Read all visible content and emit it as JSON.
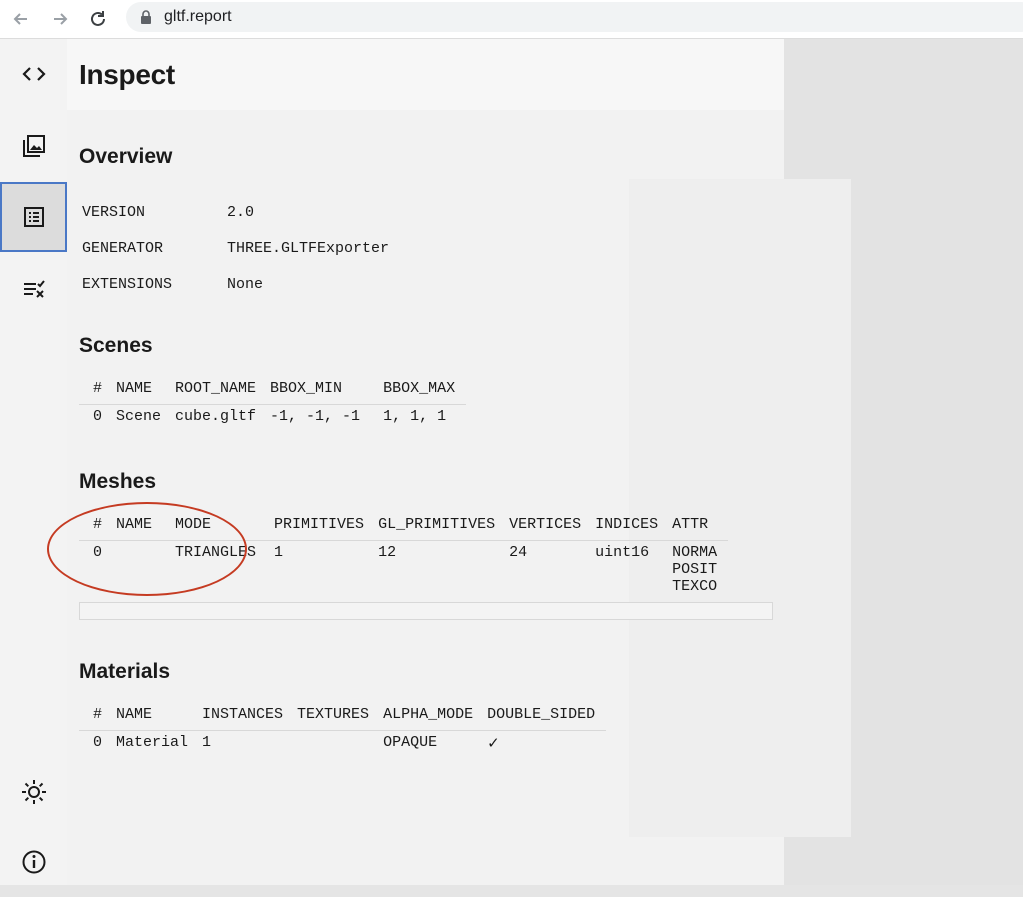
{
  "browser": {
    "url": "gltf.report",
    "back_icon": "arrow-left-icon",
    "forward_icon": "arrow-right-icon",
    "reload_icon": "reload-icon",
    "lock_icon": "lock-icon"
  },
  "sidebar": {
    "items": [
      {
        "name": "script",
        "icon": "code-icon"
      },
      {
        "name": "gallery",
        "icon": "image-stack-icon"
      },
      {
        "name": "inspect",
        "icon": "list-icon",
        "active": true
      },
      {
        "name": "validation",
        "icon": "checklist-icon"
      }
    ],
    "bottom": [
      {
        "name": "theme",
        "icon": "sun-icon"
      },
      {
        "name": "info",
        "icon": "info-icon"
      }
    ]
  },
  "page": {
    "title": "Inspect"
  },
  "overview": {
    "heading": "Overview",
    "rows": [
      {
        "key": "VERSION",
        "value": "2.0"
      },
      {
        "key": "GENERATOR",
        "value": "THREE.GLTFExporter"
      },
      {
        "key": "EXTENSIONS",
        "value": "None"
      }
    ]
  },
  "scenes": {
    "heading": "Scenes",
    "columns": [
      "#",
      "NAME",
      "ROOT_NAME",
      "BBOX_MIN",
      "BBOX_MAX"
    ],
    "rows": [
      [
        "0",
        "Scene",
        "cube.gltf",
        "-1, -1, -1",
        "1, 1, 1"
      ]
    ]
  },
  "meshes": {
    "heading": "Meshes",
    "columns": [
      "#",
      "NAME",
      "MODE",
      "PRIMITIVES",
      "GL_PRIMITIVES",
      "VERTICES",
      "INDICES",
      "ATTR"
    ],
    "rows": [
      [
        "0",
        "",
        "TRIANGLES",
        "1",
        "12",
        "24",
        "uint16",
        "NORMA"
      ]
    ],
    "attr_extra": [
      "POSIT",
      "TEXCO"
    ]
  },
  "materials": {
    "heading": "Materials",
    "columns": [
      "#",
      "NAME",
      "INSTANCES",
      "TEXTURES",
      "ALPHA_MODE",
      "DOUBLE_SIDED"
    ],
    "rows": [
      [
        "0",
        "Material",
        "1",
        "",
        "OPAQUE",
        "✓"
      ]
    ]
  },
  "annotation": {
    "color": "#c53b22"
  }
}
